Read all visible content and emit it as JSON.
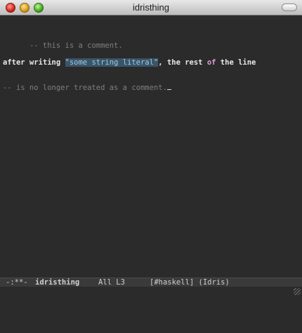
{
  "window": {
    "title": "idristhing"
  },
  "buffer": {
    "lines": [
      {
        "comment": "-- this is a comment."
      },
      {
        "prefix": "after writing ",
        "string": "\"some string literal\"",
        "after_string": ", the rest ",
        "keyword": "of",
        "suffix": " the line"
      },
      {
        "comment": "-- is no longer treated as a comment."
      }
    ]
  },
  "modeline": {
    "status": "-:**-",
    "buffer_name": "idristhing",
    "position": "All L3",
    "modes": "[#haskell] (Idris)"
  },
  "colors": {
    "comment": "#7f7f7f",
    "string_fg": "#9fc7e6",
    "string_bg": "#3b5568",
    "keyword": "#e49ad5",
    "background": "#2b2b2b"
  },
  "icons": [
    "close-icon",
    "minimize-icon",
    "zoom-icon",
    "toolbar-toggle-icon",
    "resize-grip-icon"
  ]
}
